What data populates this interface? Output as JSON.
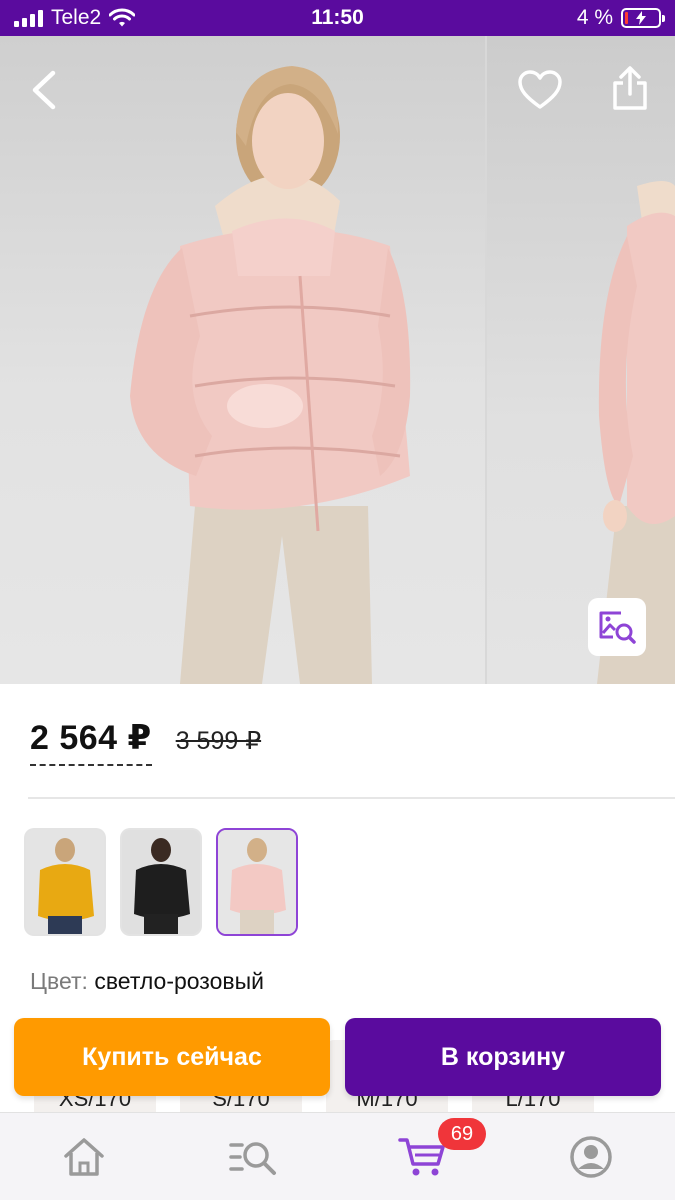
{
  "status_bar": {
    "carrier": "Tele2",
    "time": "11:50",
    "battery_percent_label": "4 %",
    "battery_level": 0.04,
    "icons": [
      "signal-icon",
      "wifi-icon",
      "battery-charging-icon"
    ]
  },
  "gallery": {
    "icons": [
      "back-arrow-icon",
      "heart-icon",
      "share-icon",
      "image-search-icon"
    ],
    "current_photo": "light-pink puffer jacket"
  },
  "product": {
    "price": "2 564 ₽",
    "old_price": "3 599 ₽"
  },
  "variants": [
    {
      "color": "#e8a912",
      "selected": false
    },
    {
      "color": "#1e1e1e",
      "selected": false
    },
    {
      "color": "#f3c9c4",
      "selected": true
    }
  ],
  "color_info": {
    "label": "Цвет:",
    "value": "светло-розовый"
  },
  "sizes": [
    {
      "label": "XS/170"
    },
    {
      "label": "S/170"
    },
    {
      "label": "M/170"
    },
    {
      "label": "L/170"
    }
  ],
  "actions": {
    "buy_now": "Купить сейчас",
    "add_to_cart": "В корзину"
  },
  "tabbar": {
    "icons": [
      "home-icon",
      "catalog-search-icon",
      "cart-icon",
      "profile-icon"
    ],
    "cart_badge": "69"
  },
  "colors": {
    "accent_purple": "#5a0b9e",
    "buy_orange": "#ff9a00",
    "badge_red": "#f0353a",
    "selected_border": "#8e44d6"
  }
}
